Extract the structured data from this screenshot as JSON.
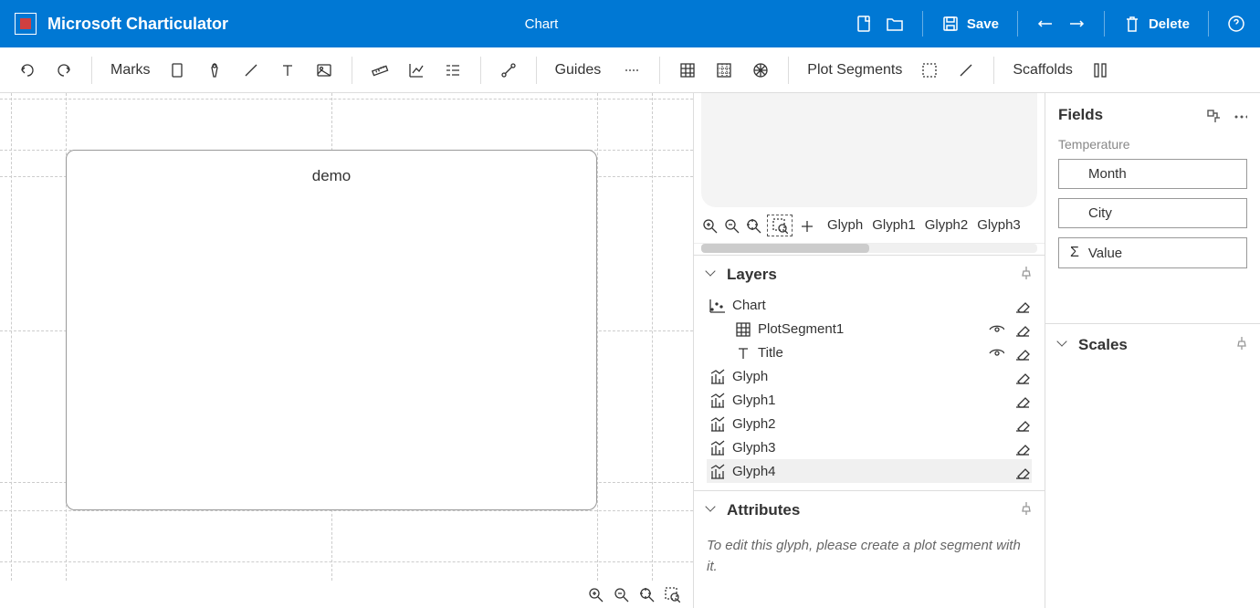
{
  "header": {
    "app_name": "Microsoft Charticulator",
    "chart_name": "Chart",
    "save_label": "Save",
    "delete_label": "Delete"
  },
  "toolbar": {
    "marks_label": "Marks",
    "guides_label": "Guides",
    "plot_segments_label": "Plot Segments",
    "scaffolds_label": "Scaffolds"
  },
  "canvas": {
    "title": "demo"
  },
  "glyph_tabs": [
    "Glyph",
    "Glyph1",
    "Glyph2",
    "Glyph3"
  ],
  "layers": {
    "header": "Layers",
    "items": [
      {
        "label": "Chart",
        "type": "chart"
      },
      {
        "label": "PlotSegment1",
        "type": "plotsegment",
        "indent": true,
        "eye": true
      },
      {
        "label": "Title",
        "type": "text",
        "indent": true,
        "eye": true
      },
      {
        "label": "Glyph",
        "type": "glyph"
      },
      {
        "label": "Glyph1",
        "type": "glyph"
      },
      {
        "label": "Glyph2",
        "type": "glyph"
      },
      {
        "label": "Glyph3",
        "type": "glyph"
      },
      {
        "label": "Glyph4",
        "type": "glyph",
        "selected": true
      }
    ]
  },
  "attributes": {
    "header": "Attributes",
    "message": "To edit this glyph, please create a plot segment with it."
  },
  "fields": {
    "header": "Fields",
    "group_label": "Temperature",
    "items": [
      {
        "label": "Month"
      },
      {
        "label": "City"
      },
      {
        "label": "Value",
        "sigma": true
      }
    ]
  },
  "scales": {
    "header": "Scales"
  }
}
